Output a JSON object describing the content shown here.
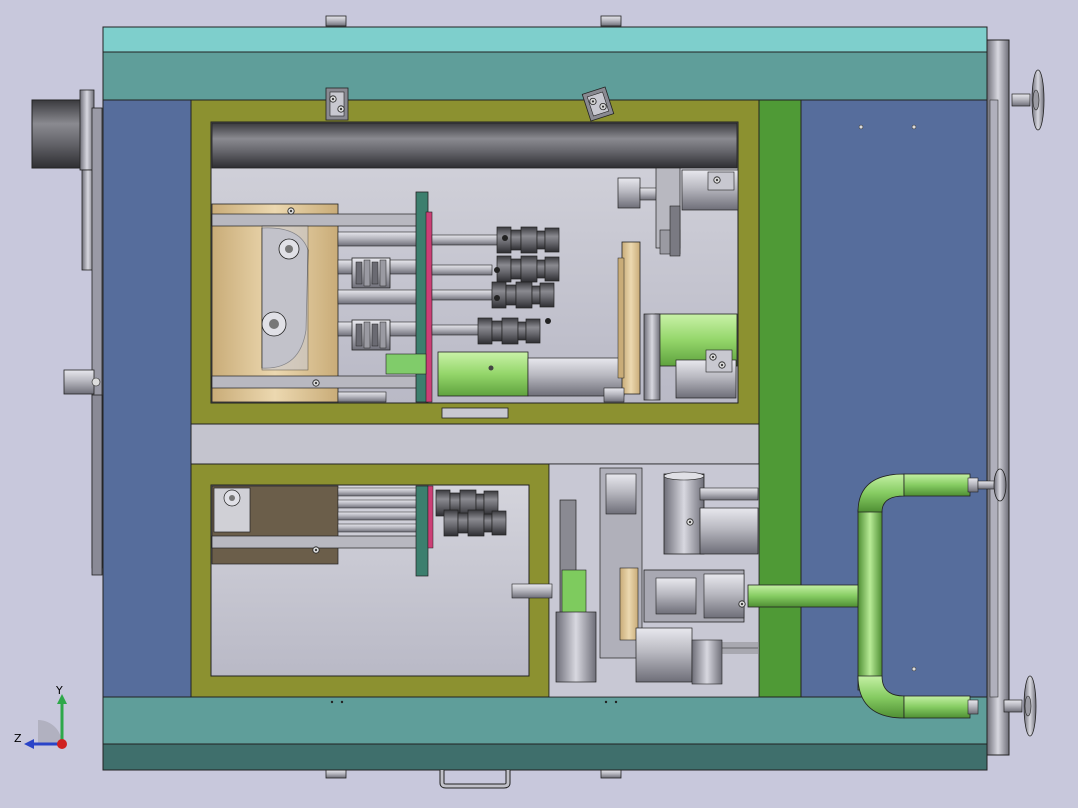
{
  "view": {
    "background": "#c8c8dc",
    "frame_teal": "#5f9e9a",
    "frame_teal_light": "#7ecfcc",
    "frame_teal_dark": "#3f6f6c",
    "panel_blue": "#566d9c",
    "panel_blue_dark": "#4a5f8c",
    "olive_frame": "#8c9130",
    "green_bar": "#4f9a36",
    "pipe_green": "#8bd070",
    "cylinder_green": "#9ada6e",
    "tan": "#d9c193",
    "metal": "#b4b4bc",
    "metal_dark": "#6a6a72",
    "outline": "#1a1a1a"
  },
  "triad": {
    "y_label": "Y",
    "z_label": "Z",
    "y_color": "#2ea84a",
    "z_color": "#2a44c8",
    "origin_color": "#d02020"
  }
}
